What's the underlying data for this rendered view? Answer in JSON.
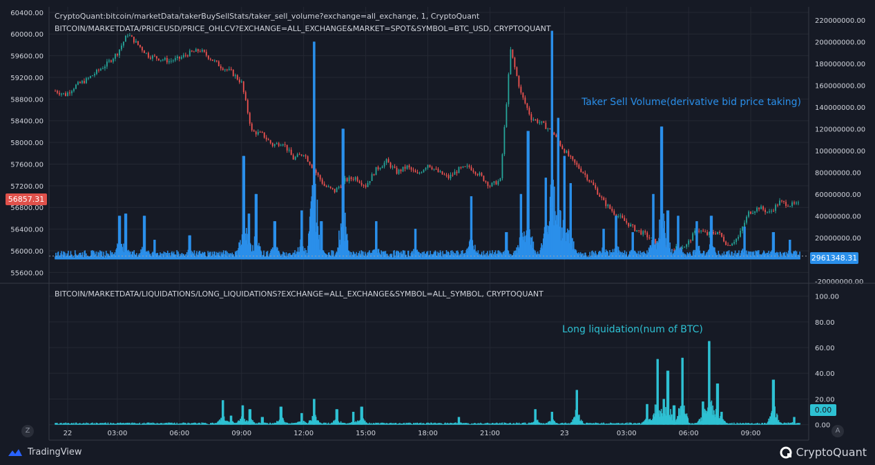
{
  "colors": {
    "background": "#161a25",
    "grid": "#242833",
    "text": "#d1d4dc",
    "volume": "#2a8fea",
    "liquidation": "#2ec1d3",
    "price_up": "#26a69a",
    "price_down": "#ef5350",
    "price_badge": "#e0514b",
    "volume_badge": "#2a8fea",
    "liq_badge": "#2ec1d3"
  },
  "legend": {
    "line1": "CryptoQuant:bitcoin/marketData/takerBuySellStats/taker_sell_volume?exchange=all_exchange, 1, CryptoQuant",
    "line2": "BITCOIN/MARKETDATA/PRICEUSD/PRICE_OHLCV?EXCHANGE=ALL_EXCHANGE&MARKET=SPOT&SYMBOL=BTC_USD, CRYPTOQUANT",
    "line3": "BITCOIN/MARKETDATA/LIQUIDATIONS/LONG_LIQUIDATIONS?EXCHANGE=ALL_EXCHANGE&SYMBOL=ALL_SYMBOL, CRYPTOQUANT"
  },
  "annotations": {
    "volume": "Taker Sell Volume(derivative bid price taking)",
    "liquidation": "Long liquidation(num of BTC)"
  },
  "badges": {
    "price": "56857.31",
    "volume": "2961348.31",
    "liquidation": "0.00"
  },
  "chart_data": [
    {
      "type": "line",
      "name": "price_ohlcv",
      "y_axis": "left",
      "ylim": [
        55400,
        60500
      ],
      "y_ticks": [
        "60400.00",
        "60000.00",
        "59600.00",
        "59200.00",
        "58800.00",
        "58400.00",
        "58000.00",
        "57600.00",
        "57200.00",
        "56800.00",
        "56400.00",
        "56000.00",
        "55600.00"
      ],
      "x": [
        0,
        0.5,
        1,
        1.5,
        2,
        2.5,
        3,
        3.5,
        4,
        4.5,
        5,
        5.5,
        6,
        6.5,
        7,
        7.5,
        8,
        8.5,
        9,
        9.5,
        10,
        10.5,
        11,
        11.5,
        12,
        12.5,
        13,
        13.5,
        14,
        14.5,
        15,
        15.5,
        16,
        16.5,
        17,
        17.5,
        18,
        18.5,
        19,
        19.5,
        20,
        20.5,
        21,
        21.5,
        22,
        22.5,
        23,
        23.5,
        24,
        24.5,
        25,
        25.5,
        26,
        26.5,
        27,
        27.5,
        28,
        28.5,
        29,
        29.5,
        30,
        30.5,
        31,
        31.5,
        32,
        32.5,
        33,
        33.5,
        34,
        34.5,
        35,
        35.5,
        36
      ],
      "values": [
        58950,
        58880,
        59050,
        59150,
        59300,
        59450,
        59650,
        60000,
        59800,
        59600,
        59550,
        59500,
        59550,
        59650,
        59700,
        59550,
        59400,
        59300,
        59100,
        58200,
        58150,
        57950,
        58000,
        57700,
        57800,
        57500,
        57200,
        57100,
        57300,
        57350,
        57200,
        57500,
        57650,
        57450,
        57550,
        57400,
        57600,
        57450,
        57350,
        57500,
        57550,
        57400,
        57200,
        57300,
        59700,
        58900,
        58450,
        58350,
        58200,
        57900,
        57650,
        57450,
        57200,
        56900,
        56700,
        56550,
        56400,
        56300,
        56150,
        56000,
        56050,
        56100,
        56400,
        56300,
        56350,
        56100,
        56250,
        56700,
        56800,
        56700,
        56900,
        56850,
        56850
      ]
    },
    {
      "type": "bar",
      "name": "taker_sell_volume",
      "y_axis": "right",
      "ylim": [
        -22000000,
        232000000
      ],
      "y_ticks": [
        "220000000.00",
        "200000000.00",
        "180000000.00",
        "160000000.00",
        "140000000.00",
        "120000000.00",
        "100000000.00",
        "80000000.00",
        "60000000.00",
        "40000000.00",
        "20000000.00",
        "0.00",
        "-20000000.00"
      ],
      "baseline_level": 5000000,
      "spikes": [
        {
          "x": 3.1,
          "value": 40000000
        },
        {
          "x": 3.4,
          "value": 42000000
        },
        {
          "x": 4.3,
          "value": 40000000
        },
        {
          "x": 4.8,
          "value": 18000000
        },
        {
          "x": 6.5,
          "value": 22000000
        },
        {
          "x": 9.1,
          "value": 95000000
        },
        {
          "x": 9.35,
          "value": 42000000
        },
        {
          "x": 9.7,
          "value": 60000000
        },
        {
          "x": 10.6,
          "value": 35000000
        },
        {
          "x": 11.9,
          "value": 45000000
        },
        {
          "x": 12.5,
          "value": 200000000
        },
        {
          "x": 12.85,
          "value": 35000000
        },
        {
          "x": 13.9,
          "value": 120000000
        },
        {
          "x": 15.5,
          "value": 35000000
        },
        {
          "x": 17.4,
          "value": 28000000
        },
        {
          "x": 20.1,
          "value": 58000000
        },
        {
          "x": 21.8,
          "value": 25000000
        },
        {
          "x": 22.5,
          "value": 60000000
        },
        {
          "x": 22.85,
          "value": 118000000
        },
        {
          "x": 23.7,
          "value": 75000000
        },
        {
          "x": 24.0,
          "value": 210000000
        },
        {
          "x": 24.3,
          "value": 130000000
        },
        {
          "x": 24.6,
          "value": 95000000
        },
        {
          "x": 24.9,
          "value": 70000000
        },
        {
          "x": 26.5,
          "value": 28000000
        },
        {
          "x": 27.1,
          "value": 40000000
        },
        {
          "x": 27.9,
          "value": 25000000
        },
        {
          "x": 28.9,
          "value": 60000000
        },
        {
          "x": 29.3,
          "value": 122000000
        },
        {
          "x": 29.6,
          "value": 45000000
        },
        {
          "x": 30.1,
          "value": 40000000
        },
        {
          "x": 31.0,
          "value": 35000000
        },
        {
          "x": 31.7,
          "value": 40000000
        },
        {
          "x": 33.3,
          "value": 30000000
        },
        {
          "x": 34.7,
          "value": 25000000
        },
        {
          "x": 35.5,
          "value": 18000000
        }
      ]
    },
    {
      "type": "bar",
      "name": "long_liquidations",
      "y_axis": "right",
      "ylim": [
        -12,
        110
      ],
      "y_ticks": [
        "100.00",
        "80.00",
        "60.00",
        "40.00",
        "20.00",
        "0.00"
      ],
      "baseline_level": 1,
      "spikes": [
        {
          "x": 8.1,
          "value": 19
        },
        {
          "x": 8.5,
          "value": 7
        },
        {
          "x": 9.05,
          "value": 15
        },
        {
          "x": 9.4,
          "value": 12
        },
        {
          "x": 10.0,
          "value": 6
        },
        {
          "x": 10.9,
          "value": 14
        },
        {
          "x": 11.9,
          "value": 9
        },
        {
          "x": 12.5,
          "value": 20
        },
        {
          "x": 13.6,
          "value": 12
        },
        {
          "x": 14.4,
          "value": 10
        },
        {
          "x": 14.8,
          "value": 14
        },
        {
          "x": 19.5,
          "value": 6
        },
        {
          "x": 23.2,
          "value": 12
        },
        {
          "x": 24.0,
          "value": 10
        },
        {
          "x": 25.2,
          "value": 27
        },
        {
          "x": 28.6,
          "value": 16
        },
        {
          "x": 29.1,
          "value": 51
        },
        {
          "x": 29.4,
          "value": 20
        },
        {
          "x": 29.6,
          "value": 42
        },
        {
          "x": 29.9,
          "value": 15
        },
        {
          "x": 30.3,
          "value": 52
        },
        {
          "x": 31.3,
          "value": 18
        },
        {
          "x": 31.6,
          "value": 65
        },
        {
          "x": 32.0,
          "value": 32
        },
        {
          "x": 32.2,
          "value": 10
        },
        {
          "x": 34.7,
          "value": 35
        },
        {
          "x": 35.7,
          "value": 6
        }
      ]
    }
  ],
  "x_axis": {
    "xlim": [
      -0.3,
      36.4
    ],
    "ticks": [
      {
        "x": 0.6,
        "label": "22"
      },
      {
        "x": 3.0,
        "label": "03:00"
      },
      {
        "x": 6.0,
        "label": "06:00"
      },
      {
        "x": 9.0,
        "label": "09:00"
      },
      {
        "x": 12.0,
        "label": "12:00"
      },
      {
        "x": 15.0,
        "label": "15:00"
      },
      {
        "x": 18.0,
        "label": "18:00"
      },
      {
        "x": 21.0,
        "label": "21:00"
      },
      {
        "x": 24.6,
        "label": "23"
      },
      {
        "x": 27.6,
        "label": "03:00"
      },
      {
        "x": 30.6,
        "label": "06:00"
      },
      {
        "x": 33.6,
        "label": "09:00"
      }
    ]
  },
  "buttons": {
    "left": "Z",
    "right": "A"
  },
  "brands": {
    "tradingview": "TradingView",
    "cryptoquant": "CryptoQuant"
  },
  "icons": {
    "tradingview": "tradingview-logo-icon",
    "cryptoquant": "cryptoquant-logo-icon"
  }
}
